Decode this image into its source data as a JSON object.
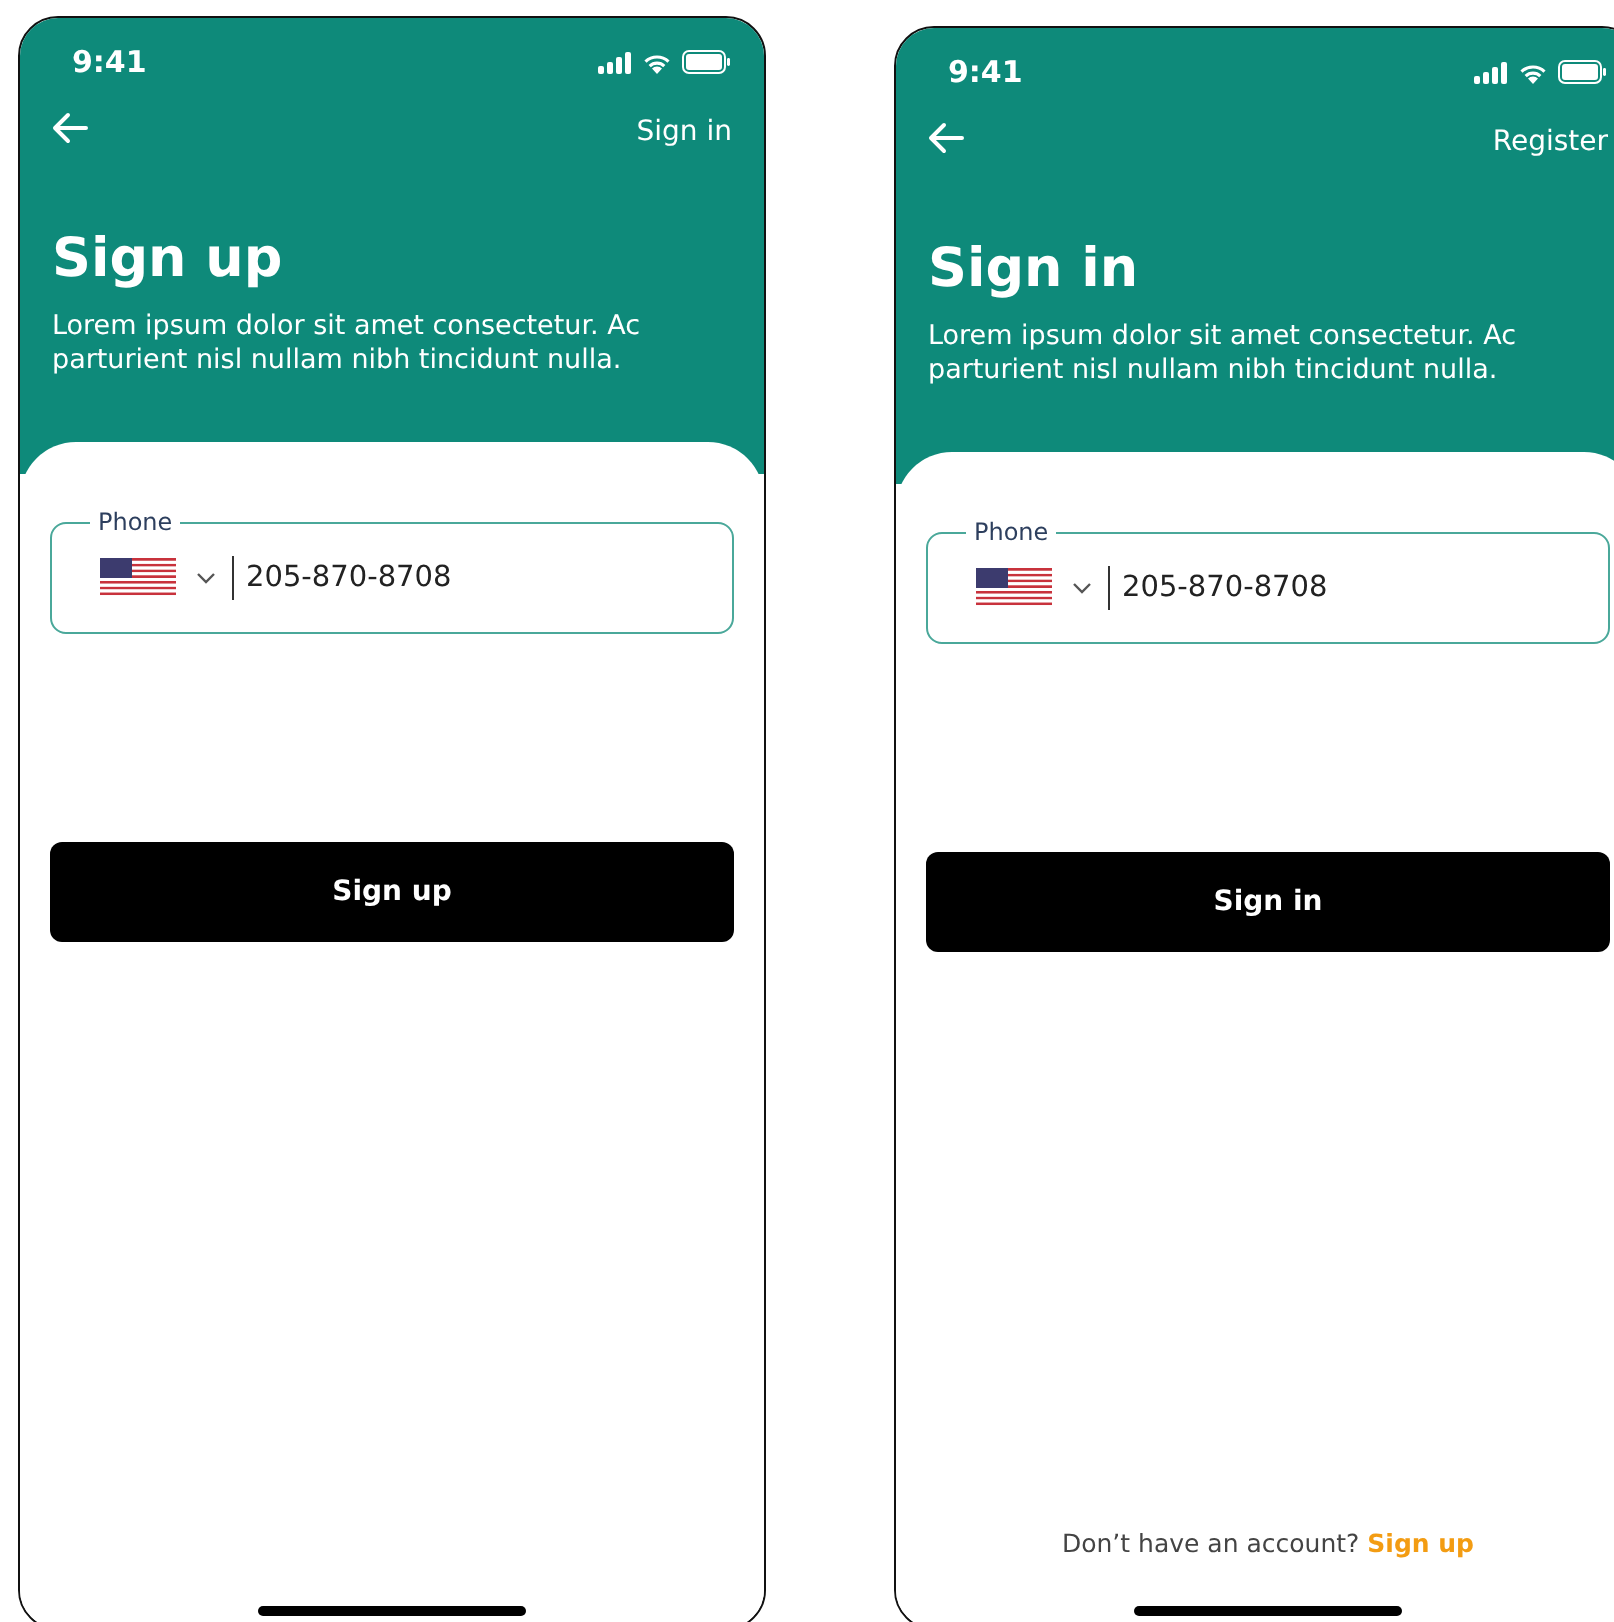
{
  "screens": [
    {
      "status_time": "9:41",
      "nav_action": "Sign in",
      "title": "Sign up",
      "description": "Lorem ipsum dolor sit amet consectetur. Ac parturient nisl nullam nibh tincidunt nulla.",
      "phone_field": {
        "label": "Phone",
        "value": "205-870-8708"
      },
      "button": "Sign up"
    },
    {
      "status_time": "9:41",
      "nav_action": "Register",
      "title": "Sign in",
      "description": "Lorem ipsum dolor sit amet consectetur. Ac parturient nisl nullam nibh tincidunt nulla.",
      "phone_field": {
        "label": "Phone",
        "value": "205-870-8708"
      },
      "button": "Sign in",
      "footer": {
        "text": "Don’t have an account?",
        "link": "Sign up"
      }
    }
  ]
}
